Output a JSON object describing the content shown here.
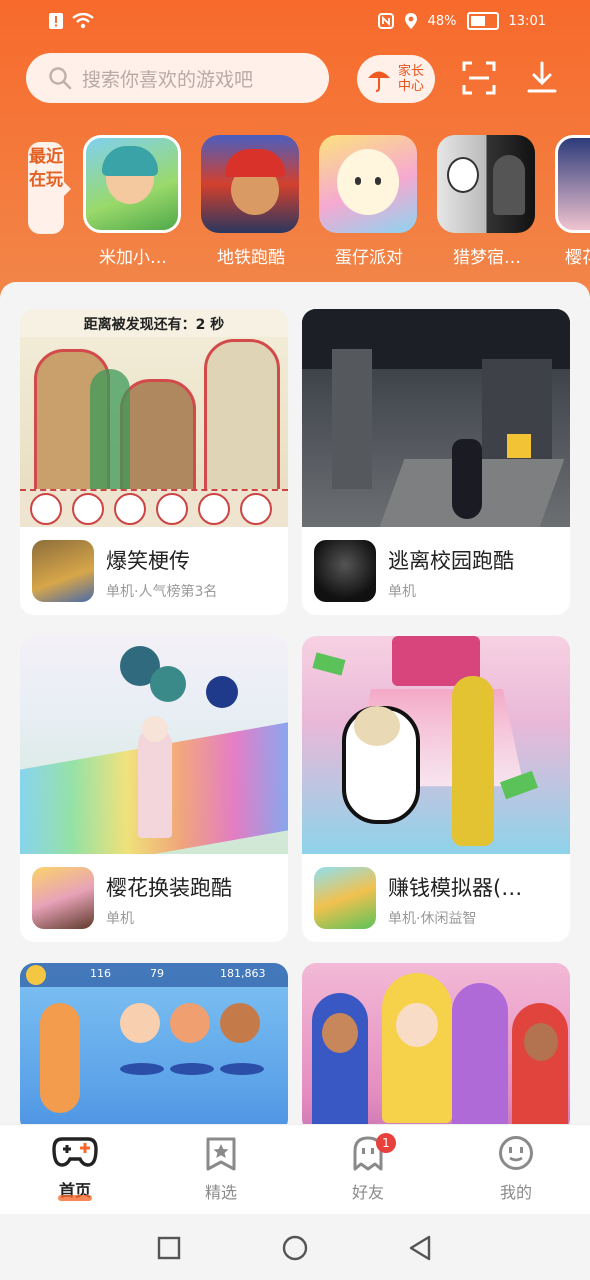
{
  "status": {
    "battery": "48%",
    "time": "13:01"
  },
  "search": {
    "placeholder": "搜索你喜欢的游戏吧"
  },
  "parent_center": {
    "label": "家长中心"
  },
  "recent": {
    "tag": "最近在玩",
    "items": [
      {
        "name": "米加小…",
        "icon": "game-icon-miga"
      },
      {
        "name": "地铁跑酷",
        "icon": "game-icon-subway"
      },
      {
        "name": "蛋仔派对",
        "icon": "game-icon-eggy"
      },
      {
        "name": "猎梦宿…",
        "icon": "game-icon-dream"
      },
      {
        "name": "樱花",
        "icon": "game-icon-sakura"
      }
    ]
  },
  "cards": [
    {
      "title": "爆笑梗传",
      "subtitle": "单机·人气榜第3名",
      "banner": "距离被发现还有：2 秒"
    },
    {
      "title": "逃离校园跑酷",
      "subtitle": "单机"
    },
    {
      "title": "樱花换装跑酷",
      "subtitle": "单机"
    },
    {
      "title": "赚钱模拟器(…",
      "subtitle": "单机·休闲益智"
    },
    {
      "title": "",
      "subtitle": "",
      "stats": [
        "116",
        "79",
        "181,863"
      ]
    },
    {
      "title": "",
      "subtitle": ""
    }
  ],
  "tabs": [
    {
      "label": "首页",
      "icon": "gamepad-icon",
      "active": true
    },
    {
      "label": "精选",
      "icon": "star-icon"
    },
    {
      "label": "好友",
      "icon": "ghost-icon",
      "badge": "1"
    },
    {
      "label": "我的",
      "icon": "face-icon"
    }
  ],
  "colors": {
    "accent": "#f76a2c",
    "tab_active": "#222222"
  }
}
